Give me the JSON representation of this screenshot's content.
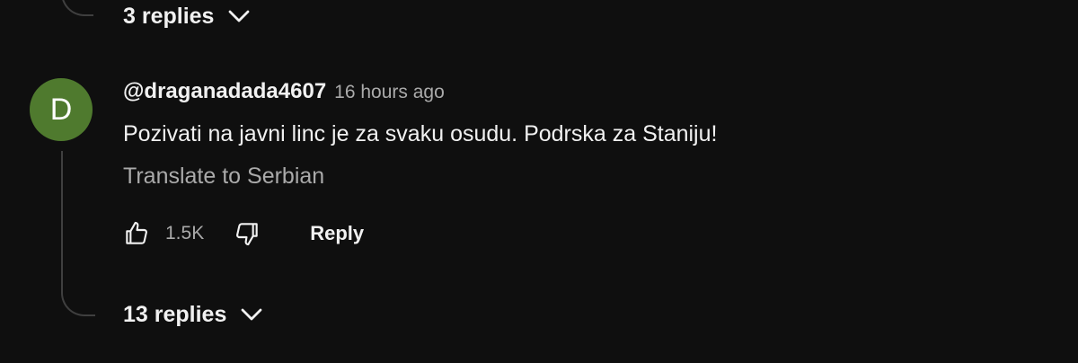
{
  "previous_thread": {
    "replies_label": "3 replies",
    "chevron_icon": "chevron-down-icon"
  },
  "comment": {
    "avatar_letter": "D",
    "avatar_color": "#4f7a2e",
    "author": "@draganadada4607",
    "timestamp": "16 hours ago",
    "text": "Pozivati na javni linc je za svaku osudu. Podrska za Staniju!",
    "translate_label": "Translate to Serbian",
    "like_icon": "thumbs-up-icon",
    "dislike_icon": "thumbs-down-icon",
    "like_count": "1.5K",
    "reply_label": "Reply",
    "replies_label": "13 replies",
    "chevron_icon": "chevron-down-icon"
  },
  "colors": {
    "background": "#0f0f0f",
    "primary_text": "#f1f1f1",
    "secondary_text": "#aaaaaa",
    "thread_line": "#3f3f3f"
  }
}
